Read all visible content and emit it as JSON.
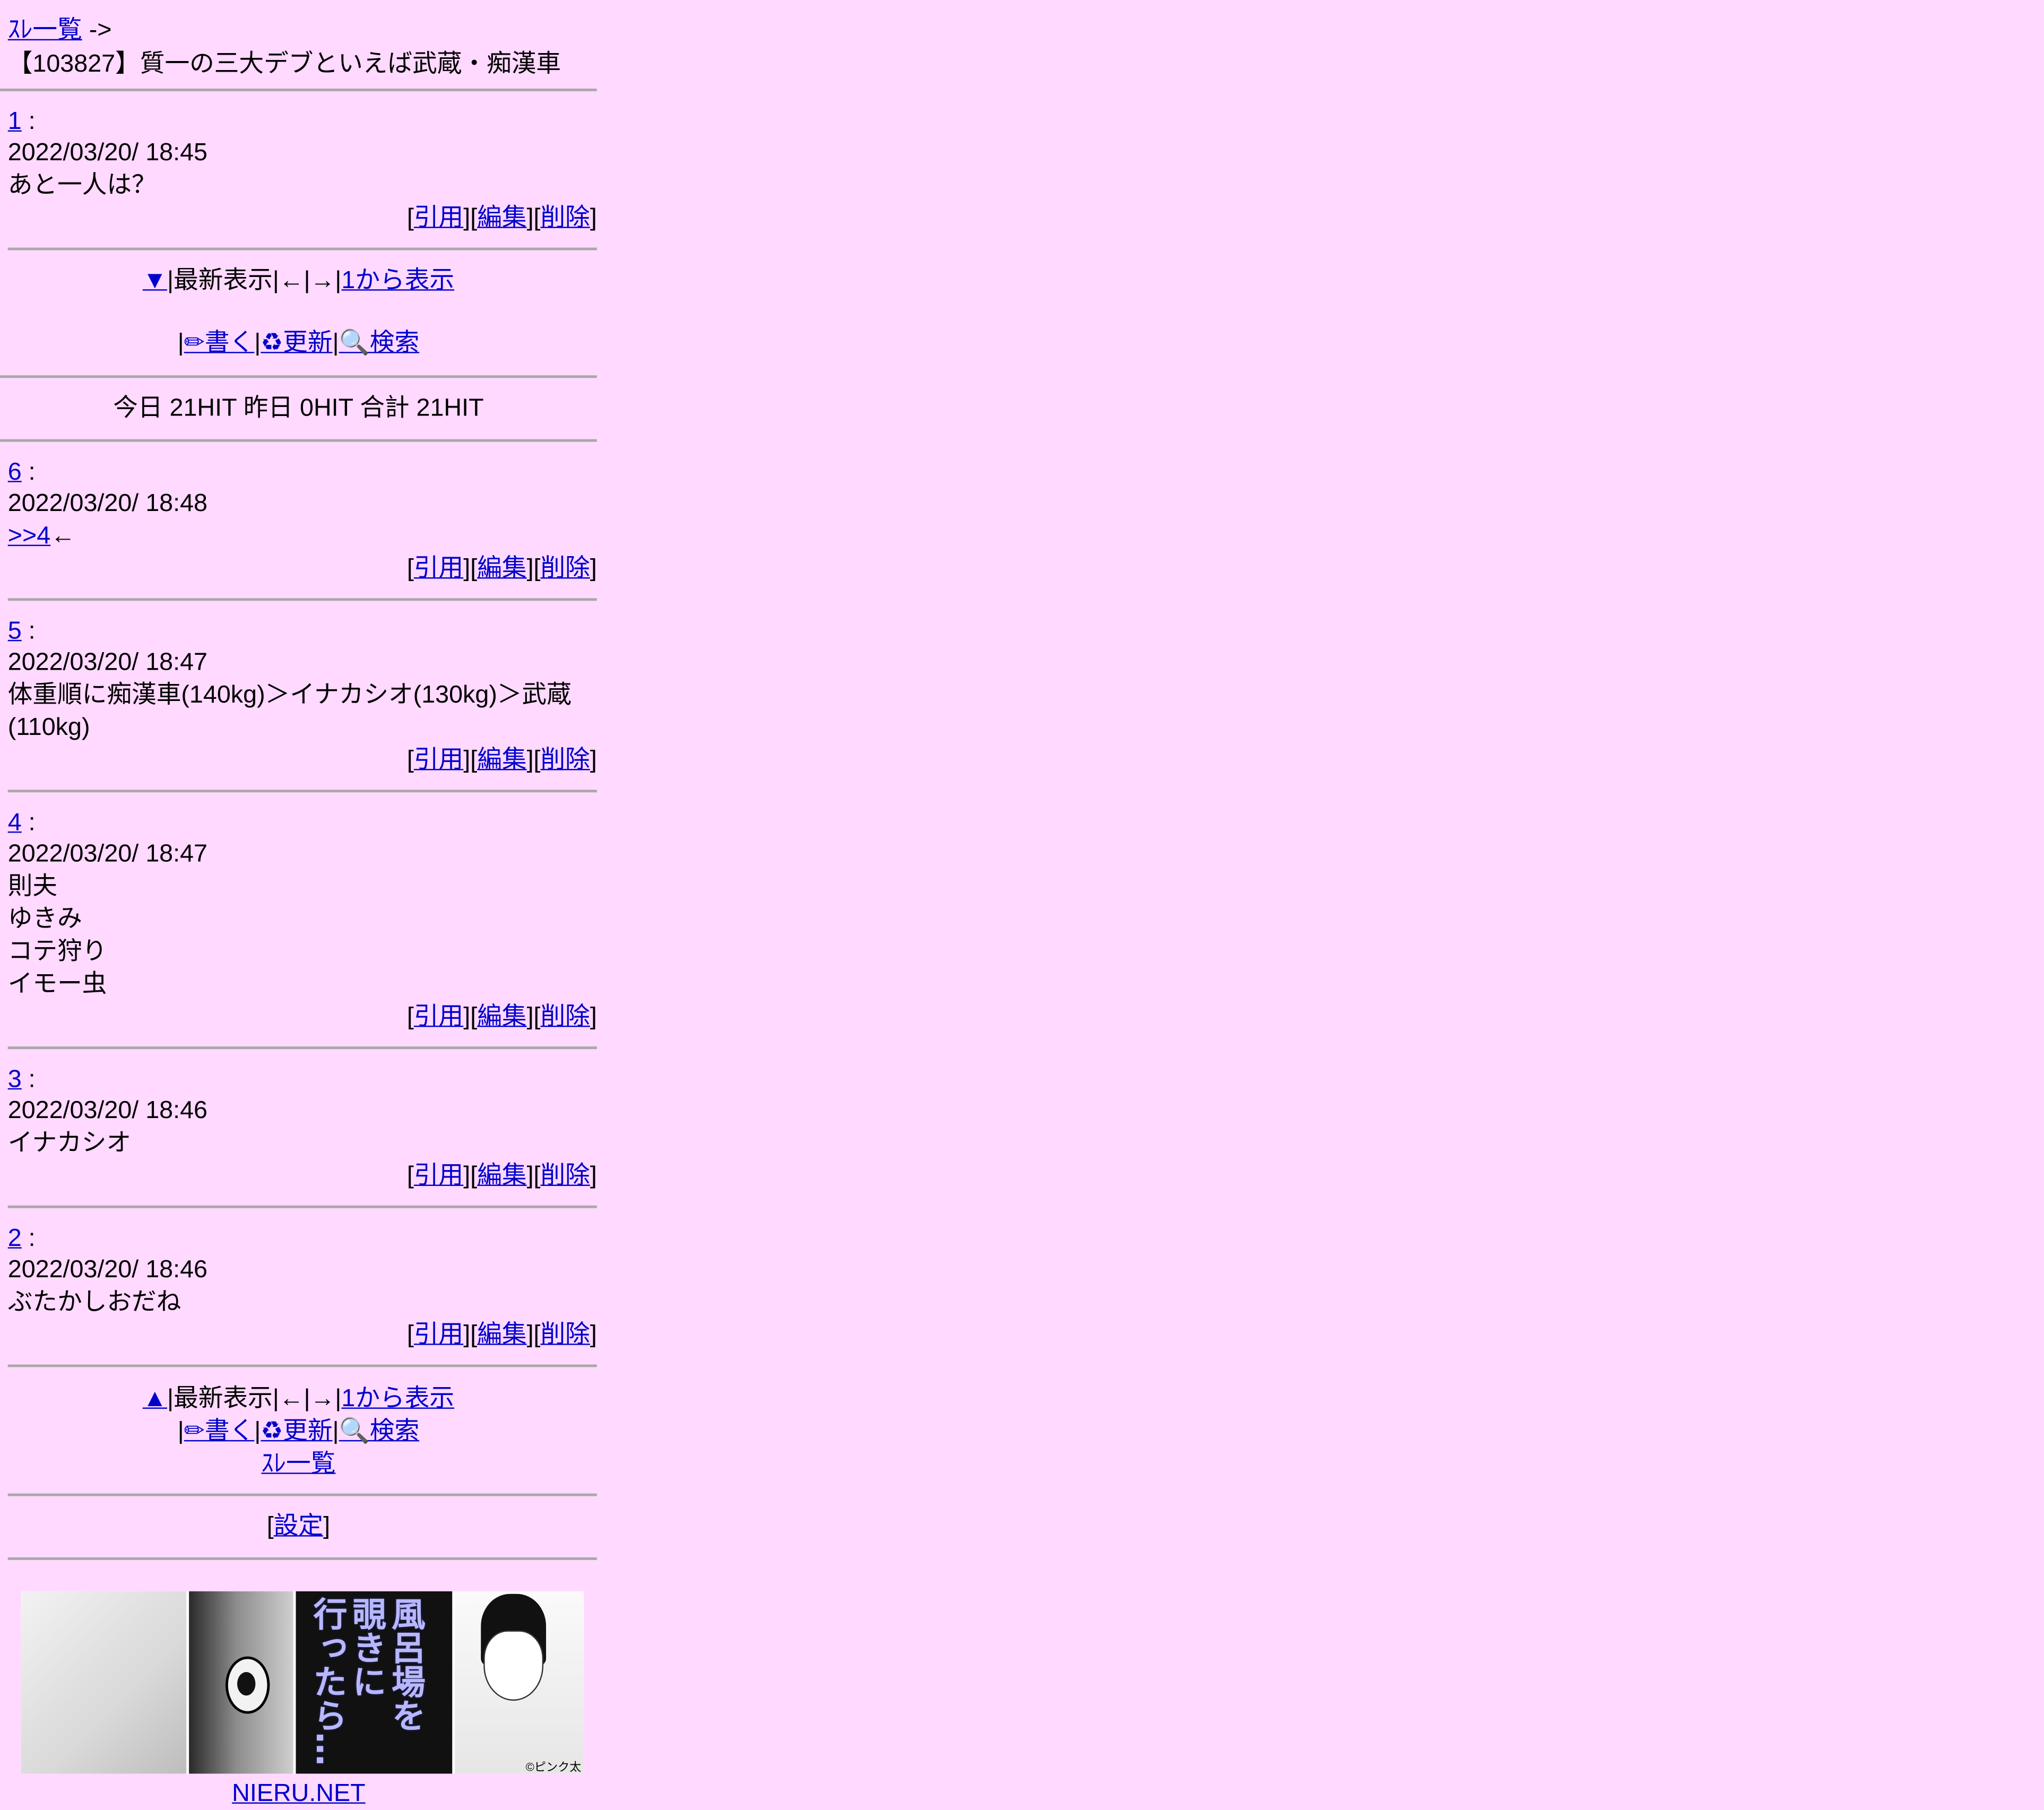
{
  "header": {
    "thread_list_link": "ｽﾚ一覧",
    "arrow": " ->",
    "thread_title": "【103827】質一の三大デブといえば武蔵・痴漢車"
  },
  "post_actions": {
    "quote": "引用",
    "edit": "編集",
    "delete": "削除"
  },
  "first_post": {
    "number": "1",
    "colon": " :",
    "date": "2022/03/20/ 18:45",
    "lines": [
      "あと一人は？"
    ]
  },
  "nav_top": {
    "down_arrow": "▼",
    "latest": "|最新表示|←|→|",
    "from_one": "1から表示",
    "write": "✏書く",
    "refresh": "♻更新",
    "search": "🔍検索"
  },
  "hits": {
    "text": "今日 21HIT 昨日 0HIT 合計 21HIT"
  },
  "posts": [
    {
      "number": "6",
      "date": "2022/03/20/ 18:48",
      "anchor": ">>4",
      "anchor_tail": "←",
      "lines": []
    },
    {
      "number": "5",
      "date": "2022/03/20/ 18:47",
      "lines": [
        "体重順に痴漢車(140kg)＞イナカシオ(130kg)＞武蔵(110kg)"
      ]
    },
    {
      "number": "4",
      "date": "2022/03/20/ 18:47",
      "lines": [
        "則夫",
        "ゆきみ",
        "コテ狩り",
        "イモー虫"
      ]
    },
    {
      "number": "3",
      "date": "2022/03/20/ 18:46",
      "lines": [
        "イナカシオ"
      ]
    },
    {
      "number": "2",
      "date": "2022/03/20/ 18:46",
      "lines": [
        "ぶたかしおだね"
      ]
    }
  ],
  "nav_bottom": {
    "up_arrow": "▲",
    "latest": "|最新表示|←|→|",
    "from_one": "1から表示",
    "write": "✏書く",
    "refresh": "♻更新",
    "search": "🔍検索",
    "thread_list": "ｽﾚ一覧"
  },
  "settings": {
    "label": "設定"
  },
  "banner": {
    "vertical_text": [
      "風呂場を",
      "覗きに",
      "行ったら…"
    ],
    "copyright": "©ピンク太",
    "link": "NIERU.NET"
  }
}
